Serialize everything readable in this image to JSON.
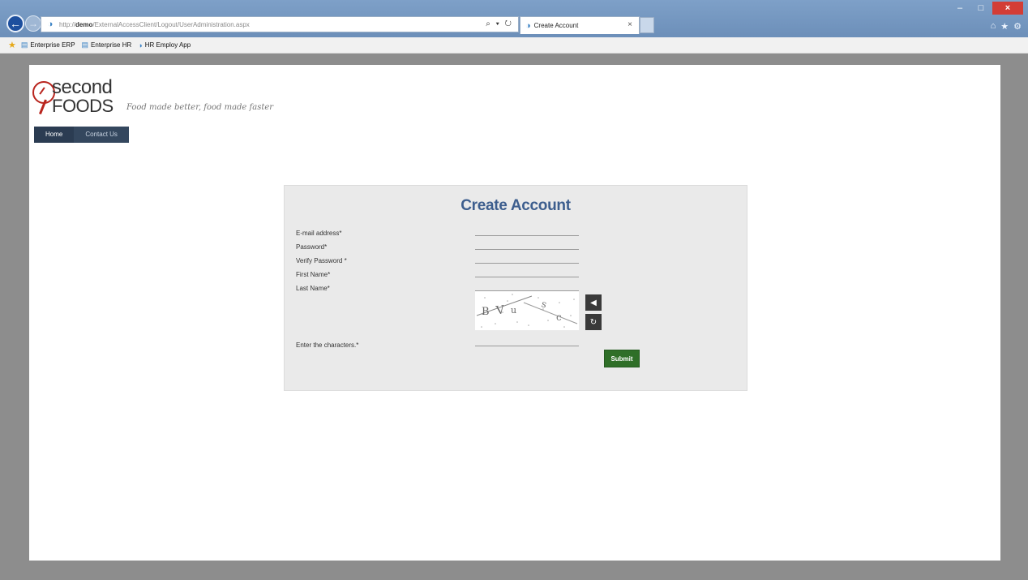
{
  "browser": {
    "address_prefix": "http://",
    "address_host": "demo",
    "address_path": "/ExternalAccessClient/Logout/UserAdministration.aspx",
    "address_tools": "⌕ ▾ ↻",
    "tab_title": "Create Account",
    "tab_close": "×",
    "window_buttons": {
      "minimize": "–",
      "maximize": "□",
      "close": "×"
    },
    "right_icons": {
      "home": "⌂",
      "favorites": "★",
      "tools": "⚙"
    }
  },
  "favorites_bar": {
    "items": [
      {
        "label": "Enterprise ERP",
        "icon": "page-icon"
      },
      {
        "label": "Enterprise HR",
        "icon": "page-icon"
      },
      {
        "label": "HR Employ App",
        "icon": "ie-icon"
      }
    ]
  },
  "site": {
    "logo_second": "second",
    "logo_foods": "FOODS",
    "tagline": "Food made better, food made faster",
    "nav": [
      {
        "label": "Home"
      },
      {
        "label": "Contact Us"
      }
    ]
  },
  "form": {
    "title": "Create Account",
    "fields": [
      {
        "label": "E-mail address*",
        "value": ""
      },
      {
        "label": "Password*",
        "value": ""
      },
      {
        "label": "Verify Password *",
        "value": ""
      },
      {
        "label": "First Name*",
        "value": ""
      },
      {
        "label": "Last Name*",
        "value": ""
      }
    ],
    "captcha_label": "Enter the characters.*",
    "captcha_value": "",
    "captcha_text": [
      "B",
      "V",
      "u",
      "s",
      "c"
    ],
    "audio_icon": "◀",
    "refresh_icon": "↻",
    "submit_label": "Submit"
  },
  "colors": {
    "accent": "#3d5e8e",
    "nav_bg": "#34475e",
    "submit_bg": "#2f6f28",
    "logo_red": "#b9251e"
  }
}
